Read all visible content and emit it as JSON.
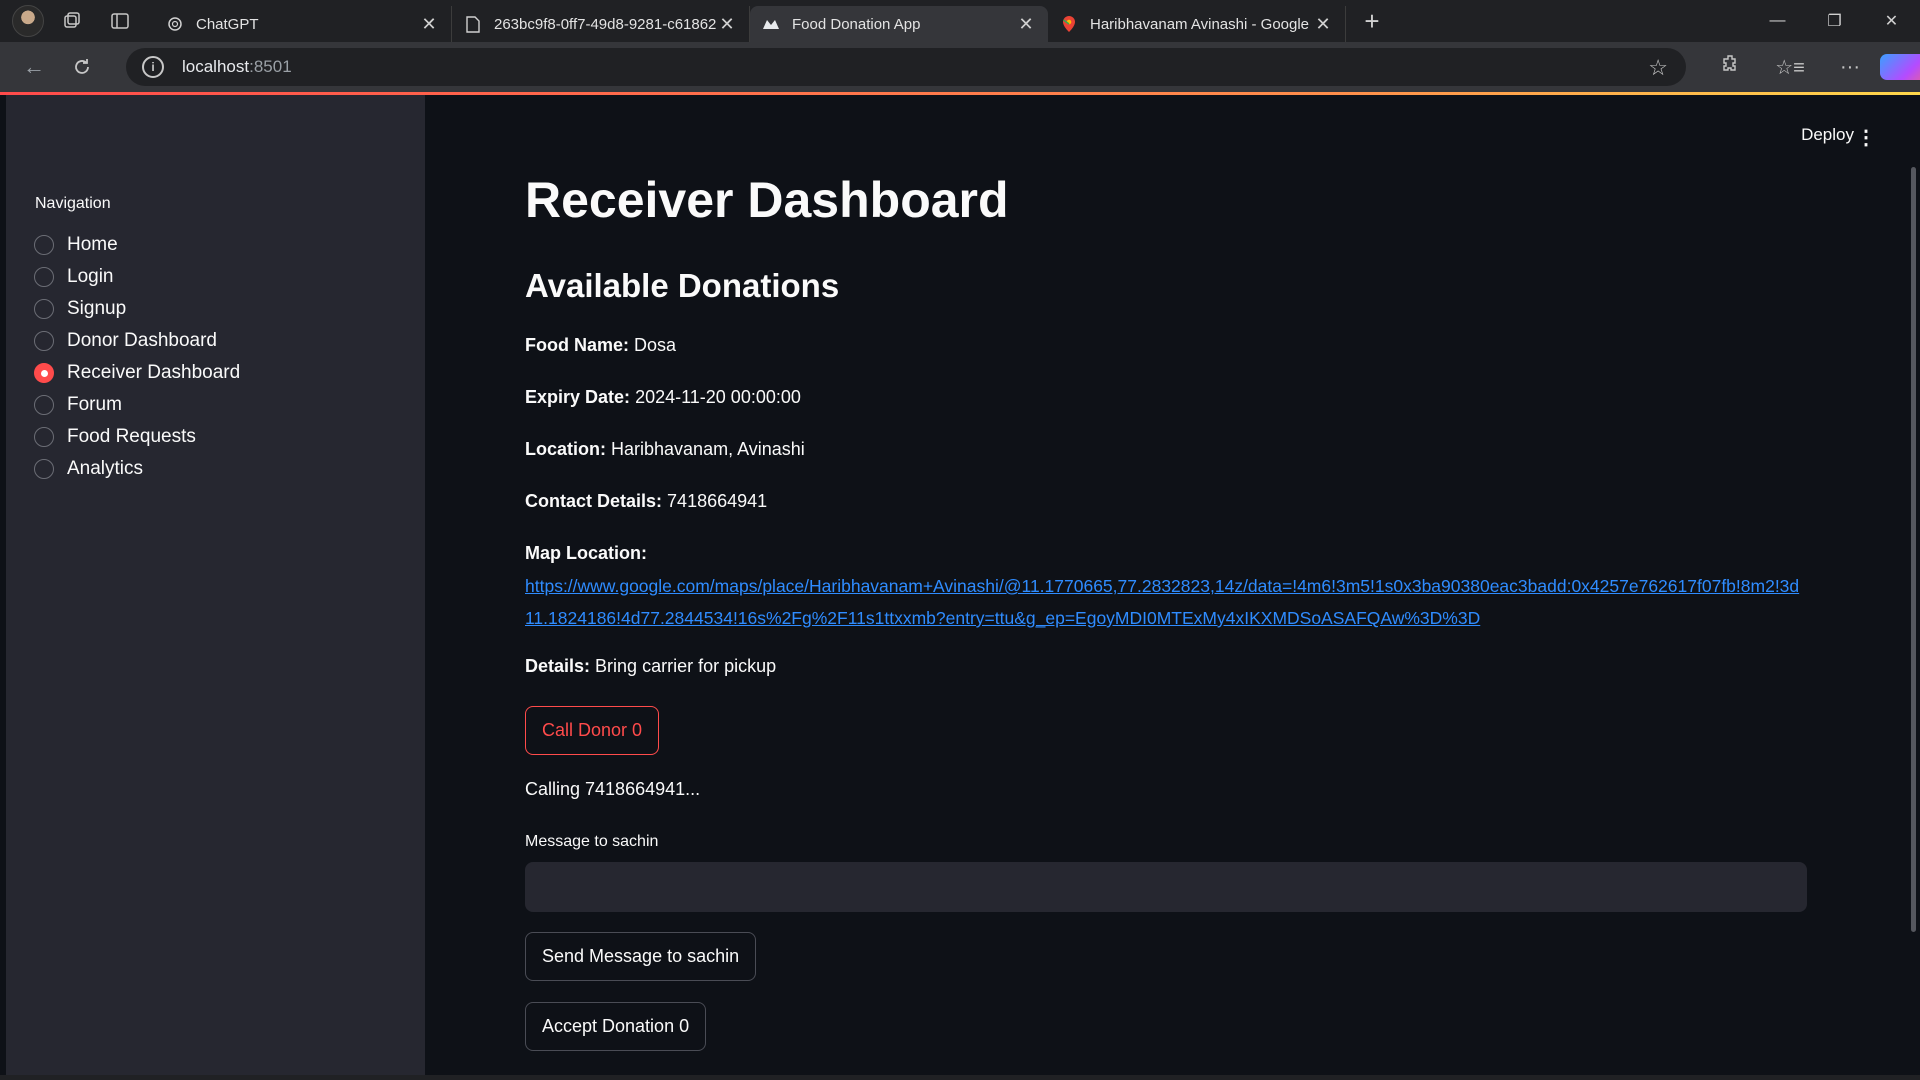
{
  "browser": {
    "tabs": [
      {
        "title": "ChatGPT",
        "active": false
      },
      {
        "title": "263bc9f8-0ff7-49d8-9281-c61862",
        "active": false
      },
      {
        "title": "Food Donation App",
        "active": true
      },
      {
        "title": "Haribhavanam Avinashi - Google",
        "active": false
      }
    ],
    "url_host": "localhost",
    "url_port": ":8501"
  },
  "app": {
    "deploy_label": "Deploy",
    "sidebar": {
      "title": "Navigation",
      "items": [
        {
          "label": "Home",
          "selected": false
        },
        {
          "label": "Login",
          "selected": false
        },
        {
          "label": "Signup",
          "selected": false
        },
        {
          "label": "Donor Dashboard",
          "selected": false
        },
        {
          "label": "Receiver Dashboard",
          "selected": true
        },
        {
          "label": "Forum",
          "selected": false
        },
        {
          "label": "Food Requests",
          "selected": false
        },
        {
          "label": "Analytics",
          "selected": false
        }
      ]
    },
    "main": {
      "title": "Receiver Dashboard",
      "section_title": "Available Donations",
      "donation": {
        "food_name_label": "Food Name:",
        "food_name": "Dosa",
        "expiry_label": "Expiry Date:",
        "expiry": "2024-11-20 00:00:00",
        "location_label": "Location:",
        "location": "Haribhavanam, Avinashi",
        "contact_label": "Contact Details:",
        "contact": "7418664941",
        "map_label": "Map Location:",
        "map_url": "https://www.google.com/maps/place/Haribhavanam+Avinashi/@11.1770665,77.2832823,14z/data=!4m6!3m5!1s0x3ba90380eac3badd:0x4257e762617f07fb!8m2!3d11.1824186!4d77.2844534!16s%2Fg%2F11s1ttxxmb?entry=ttu&g_ep=EgoyMDI0MTExMy4xIKXMDSoASAFQAw%3D%3D",
        "details_label": "Details:",
        "details": "Bring carrier for pickup"
      },
      "call_button": "Call Donor 0",
      "calling_status": "Calling 7418664941...",
      "message_label": "Message to sachin",
      "message_value": "",
      "send_button": "Send Message to sachin",
      "accept_button": "Accept Donation 0"
    }
  },
  "colors": {
    "accent": "#ff4b4b",
    "link": "#2f8cff",
    "sidebar_bg": "#262730",
    "main_bg": "#0e1117"
  }
}
